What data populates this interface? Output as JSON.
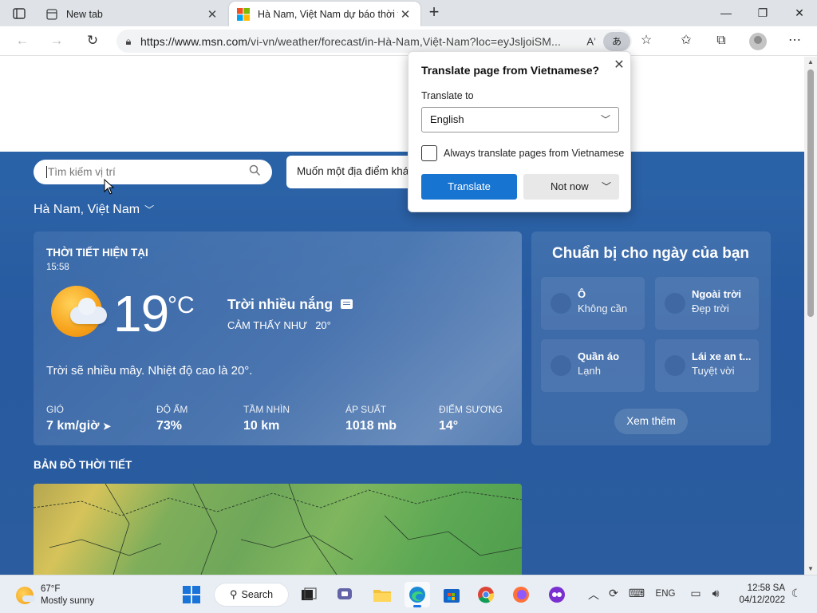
{
  "browser": {
    "tabs": [
      {
        "title": "New tab",
        "active": false
      },
      {
        "title": "Hà Nam, Việt Nam dự báo thời tiết",
        "active": true
      }
    ],
    "url_host": "https://www.msn.com",
    "url_path": "/vi-vn/weather/forecast/in-Hà-Nam,Việt-Nam?loc=eyJsljoiSM...",
    "translate_pill": "あ"
  },
  "page": {
    "search_placeholder": "Tìm kiếm vị trí",
    "suggest_text": "Muốn một địa điểm khác?",
    "location": "Hà Nam, Việt Nam",
    "current": {
      "title": "THỜI TIẾT HIỆN TẠI",
      "time": "15:58",
      "temp": "19",
      "unit": "°C",
      "condition": "Trời nhiều nắng",
      "feels_label": "CẢM THẤY NHƯ",
      "feels_value": "20°",
      "summary": "Trời sẽ nhiều mây. Nhiệt độ cao là 20°.",
      "stats": [
        {
          "label": "GIÓ",
          "value": "7 km/giờ"
        },
        {
          "label": "ĐỘ ẨM",
          "value": "73%"
        },
        {
          "label": "TẦM NHÌN",
          "value": "10 km"
        },
        {
          "label": "ÁP SUẤT",
          "value": "1018 mb"
        },
        {
          "label": "ĐIỂM SƯƠNG",
          "value": "14°"
        }
      ]
    },
    "prep": {
      "title": "Chuẩn bị cho ngày của bạn",
      "items": [
        {
          "name": "Ô",
          "sub": "Không cần"
        },
        {
          "name": "Ngoài trời",
          "sub": "Đẹp trời"
        },
        {
          "name": "Quần áo",
          "sub": "Lạnh"
        },
        {
          "name": "Lái xe an t...",
          "sub": "Tuyệt vời"
        }
      ],
      "see_more": "Xem thêm"
    },
    "map_title": "BẢN ĐỒ THỜI TIẾT"
  },
  "translate_popup": {
    "title": "Translate page from Vietnamese?",
    "translate_to_label": "Translate to",
    "selected_language": "English",
    "always_label": "Always translate pages from Vietnamese",
    "translate_button": "Translate",
    "not_now_button": "Not now"
  },
  "taskbar": {
    "weather_temp": "67°F",
    "weather_cond": "Mostly sunny",
    "search_label": "Search",
    "language": "ENG",
    "time": "12:58 SA",
    "date": "04/12/2022"
  },
  "colors": {
    "accent": "#1874d1",
    "weather_bg": "#2a5c9f"
  }
}
